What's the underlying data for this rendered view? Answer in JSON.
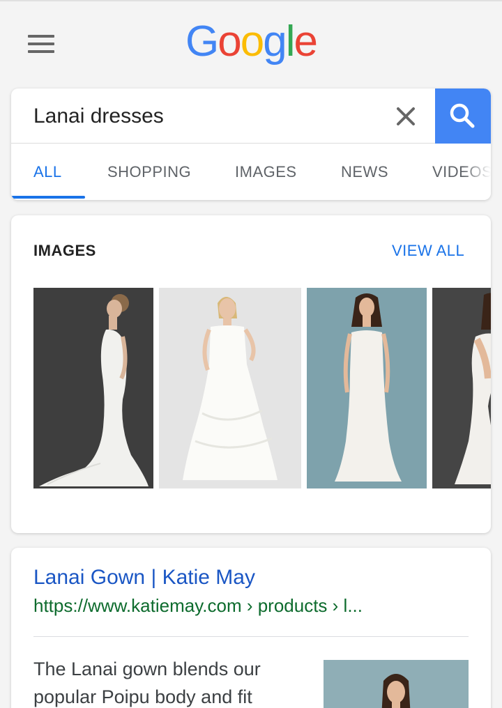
{
  "header": {
    "logo_letters": [
      {
        "char": "G",
        "color": "#4285F4"
      },
      {
        "char": "o",
        "color": "#EA4335"
      },
      {
        "char": "o",
        "color": "#FBBC05"
      },
      {
        "char": "g",
        "color": "#4285F4"
      },
      {
        "char": "l",
        "color": "#34A853"
      },
      {
        "char": "e",
        "color": "#EA4335"
      }
    ],
    "menu_icon": "hamburger-menu-icon"
  },
  "search": {
    "query": "Lanai dresses",
    "clear_icon": "close-icon",
    "submit_icon": "search-icon",
    "accent_color": "#4285F4"
  },
  "tabs": [
    {
      "label": "ALL",
      "active": true
    },
    {
      "label": "SHOPPING",
      "active": false
    },
    {
      "label": "IMAGES",
      "active": false
    },
    {
      "label": "NEWS",
      "active": false
    },
    {
      "label": "VIDEOS",
      "active": false
    }
  ],
  "images_section": {
    "title": "IMAGES",
    "view_all": "VIEW ALL",
    "thumbnails": [
      {
        "background": "#3f3f3f"
      },
      {
        "background": "#e3e3e3"
      },
      {
        "background": "#7fa3ad"
      },
      {
        "background": "#474747"
      }
    ]
  },
  "result": {
    "title": "Lanai Gown | Katie May",
    "url": "https://www.katiemay.com › products › l...",
    "snippet": "The Lanai gown blends our popular Poipu body and fit"
  }
}
